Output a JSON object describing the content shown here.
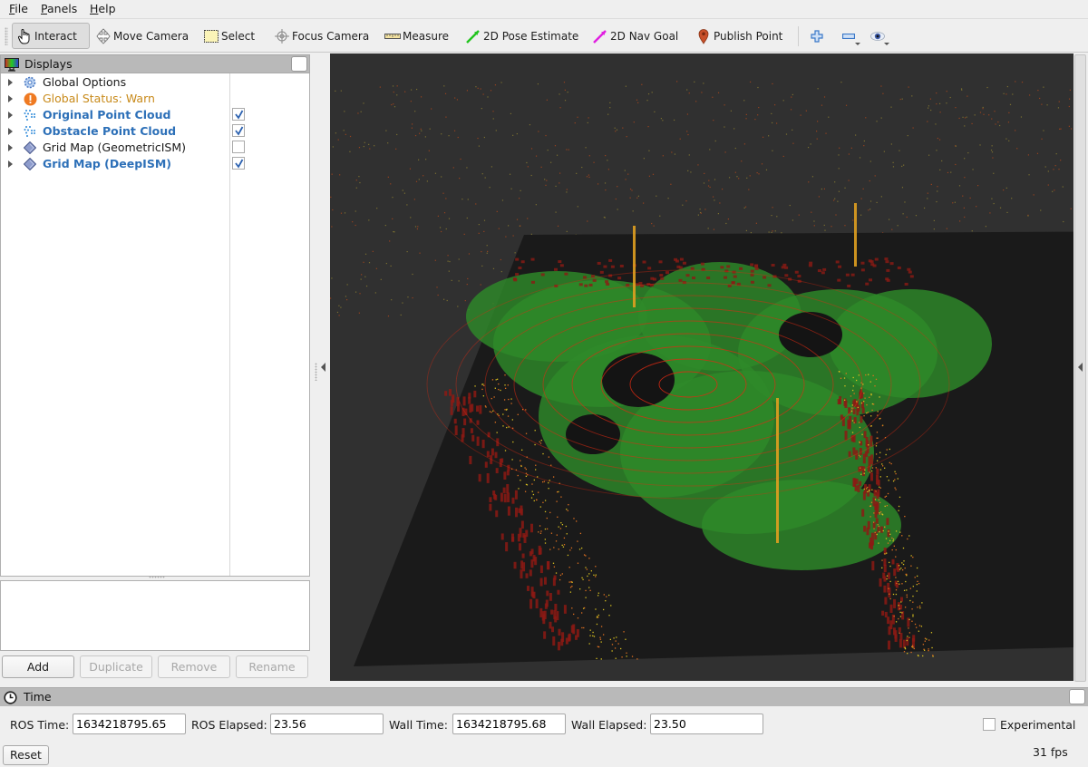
{
  "menu": {
    "items": [
      {
        "label": "File",
        "mnemonic": "F",
        "rest": "ile"
      },
      {
        "label": "Panels",
        "mnemonic": "P",
        "rest": "anels"
      },
      {
        "label": "Help",
        "mnemonic": "H",
        "rest": "elp"
      }
    ]
  },
  "toolbar": {
    "tools": [
      {
        "label": "Interact",
        "icon": "hand-pointer-icon",
        "active": true
      },
      {
        "label": "Move Camera",
        "icon": "move-camera-icon"
      },
      {
        "label": "Select",
        "icon": "select-rect-icon"
      },
      {
        "label": "Focus Camera",
        "icon": "focus-camera-icon"
      },
      {
        "label": "Measure",
        "icon": "ruler-icon"
      },
      {
        "label": "2D Pose Estimate",
        "icon": "green-arrow-icon"
      },
      {
        "label": "2D Nav Goal",
        "icon": "magenta-arrow-icon"
      },
      {
        "label": "Publish Point",
        "icon": "map-pin-icon"
      }
    ],
    "extra": [
      "add-tool-icon",
      "remove-tool-icon",
      "view-eye-icon"
    ]
  },
  "displays": {
    "title": "Displays",
    "items": [
      {
        "label": "Global Options",
        "icon": "gear-icon",
        "style": "normal",
        "checkbox": null
      },
      {
        "label": "Global Status: Warn",
        "icon": "warning-icon",
        "style": "warn",
        "checkbox": null
      },
      {
        "label": "Original Point Cloud",
        "icon": "point-cloud-icon",
        "style": "bold",
        "checkbox": true
      },
      {
        "label": "Obstacle Point Cloud",
        "icon": "point-cloud-icon",
        "style": "bold",
        "checkbox": true
      },
      {
        "label": "Grid Map (GeometricISM)",
        "icon": "grid-map-icon",
        "style": "normal",
        "checkbox": false
      },
      {
        "label": "Grid Map (DeepISM)",
        "icon": "grid-map-icon",
        "style": "bold",
        "checkbox": true
      }
    ],
    "buttons": [
      {
        "label": "Add",
        "enabled": true
      },
      {
        "label": "Duplicate",
        "enabled": false
      },
      {
        "label": "Remove",
        "enabled": false
      },
      {
        "label": "Rename",
        "enabled": false
      }
    ]
  },
  "time": {
    "title": "Time",
    "ros_time_label": "ROS Time:",
    "ros_time": "1634218795.65",
    "ros_elapsed_label": "ROS Elapsed:",
    "ros_elapsed": "23.56",
    "wall_time_label": "Wall Time:",
    "wall_time": "1634218795.68",
    "wall_elapsed_label": "Wall Elapsed:",
    "wall_elapsed": "23.50",
    "experimental_label": "Experimental",
    "experimental_checked": false,
    "reset_label": "Reset",
    "fps": "31 fps"
  },
  "colors": {
    "viewport_bg": "#303030",
    "grid_plane": "#1a1a1a",
    "free_space": "#2e8a2a",
    "occupied": "#8c1a14",
    "points_near": "#d8c020",
    "points_far": "#c04a18",
    "accent_bold": "#2d70b8",
    "warn": "#c88a1a"
  }
}
